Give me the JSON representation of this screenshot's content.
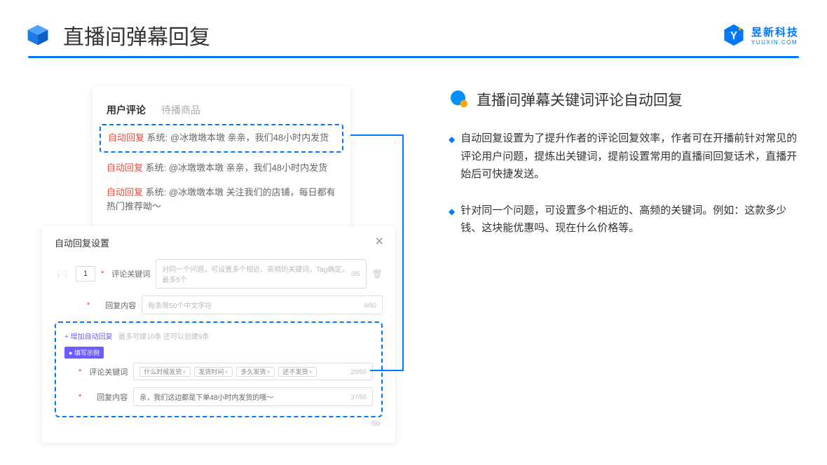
{
  "header": {
    "title": "直播间弹幕回复",
    "brand_cn": "昱新科技",
    "brand_en": "YUUXIN.COM"
  },
  "comments": {
    "tabs": [
      "用户评论",
      "待播商品"
    ],
    "rows": [
      {
        "tag": "自动回复",
        "text": "系统: @冰墩墩本墩 亲亲，我们48小时内发货"
      },
      {
        "tag": "自动回复",
        "text": "系统: @冰墩墩本墩 亲亲，我们48小时内发货"
      },
      {
        "tag": "自动回复",
        "text": "系统: @冰墩墩本墩 关注我们的店铺，每日都有热门推荐呦～"
      }
    ]
  },
  "settings": {
    "title": "自动回复设置",
    "num": "1",
    "keyword_label": "评论关键词",
    "keyword_placeholder": "对同一个问题，可设置多个相近、高频的关键词，Tag确定，最多5个",
    "keyword_counter": "0/5",
    "content_label": "回复内容",
    "content_placeholder": "每条限50个中文字符",
    "content_counter": "0/50",
    "add_text": "+ 增加自动回复",
    "add_hint": "最多可建10条 还可以创建9条",
    "example_badge": "● 填写示例",
    "ex_keyword_label": "评论关键词",
    "ex_chips": [
      "什么时候发货",
      "发货时间",
      "多久发货",
      "还不发货"
    ],
    "ex_kw_counter": "20/50",
    "ex_content_label": "回复内容",
    "ex_content_text": "亲，我们这边都是下单48小时内发货的哦～",
    "ex_content_counter": "37/50",
    "outer_counter": "/50"
  },
  "explain": {
    "title": "直播间弹幕关键词评论自动回复",
    "bullets": [
      "自动回复设置为了提升作者的评论回复效率，作者可在开播前针对常见的评论用户问题，提炼出关键词，提前设置常用的直播间回复话术，直播开始后可快捷发送。",
      "针对同一个问题，可设置多个相近的、高频的关键词。例如：这款多少钱、这块能优惠吗、现在什么价格等。"
    ]
  }
}
